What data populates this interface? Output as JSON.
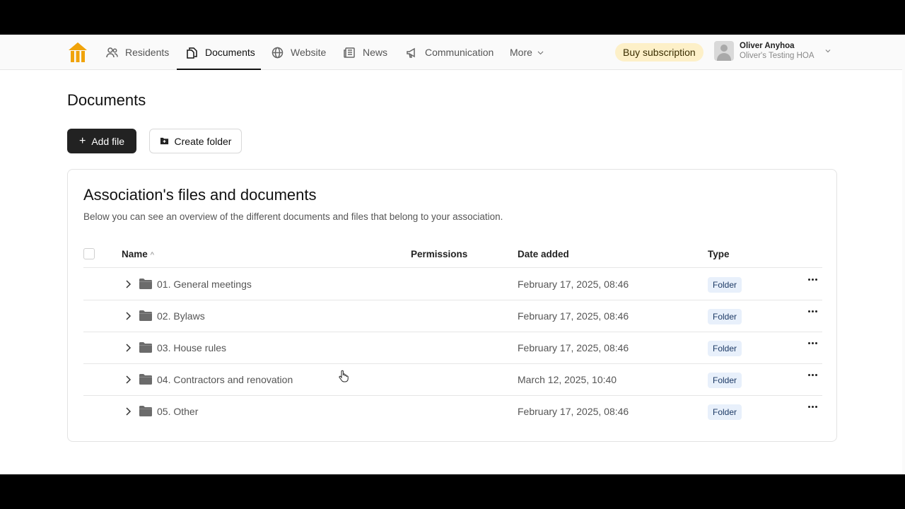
{
  "nav": {
    "items": [
      {
        "label": "Residents",
        "icon": "residents-icon"
      },
      {
        "label": "Documents",
        "icon": "documents-icon",
        "active": true
      },
      {
        "label": "Website",
        "icon": "globe-icon"
      },
      {
        "label": "News",
        "icon": "newspaper-icon"
      },
      {
        "label": "Communication",
        "icon": "megaphone-icon"
      },
      {
        "label": "More",
        "icon": "chevron-down-icon"
      }
    ],
    "buy_label": "Buy subscription",
    "user_name": "Oliver Anyhoa",
    "user_org": "Oliver's Testing HOA"
  },
  "page": {
    "title": "Documents",
    "add_file_label": "Add file",
    "create_folder_label": "Create folder"
  },
  "card": {
    "title": "Association's files and documents",
    "subtitle": "Below you can see an overview of the different documents and files that belong to your association."
  },
  "table": {
    "headers": {
      "name": "Name",
      "permissions": "Permissions",
      "date": "Date added",
      "type": "Type"
    },
    "rows": [
      {
        "name": "01. General meetings",
        "date": "February 17, 2025, 08:46",
        "type": "Folder"
      },
      {
        "name": "02. Bylaws",
        "date": "February 17, 2025, 08:46",
        "type": "Folder"
      },
      {
        "name": "03. House rules",
        "date": "February 17, 2025, 08:46",
        "type": "Folder"
      },
      {
        "name": "04. Contractors and renovation",
        "date": "March 12, 2025, 10:40",
        "type": "Folder"
      },
      {
        "name": "05. Other",
        "date": "February 17, 2025, 08:46",
        "type": "Folder"
      }
    ]
  },
  "colors": {
    "accent_logo": "#f0a30a",
    "primary_button": "#222222",
    "buy_badge_bg": "#fdf0c8",
    "folder_badge_bg": "#e8f0fb"
  }
}
